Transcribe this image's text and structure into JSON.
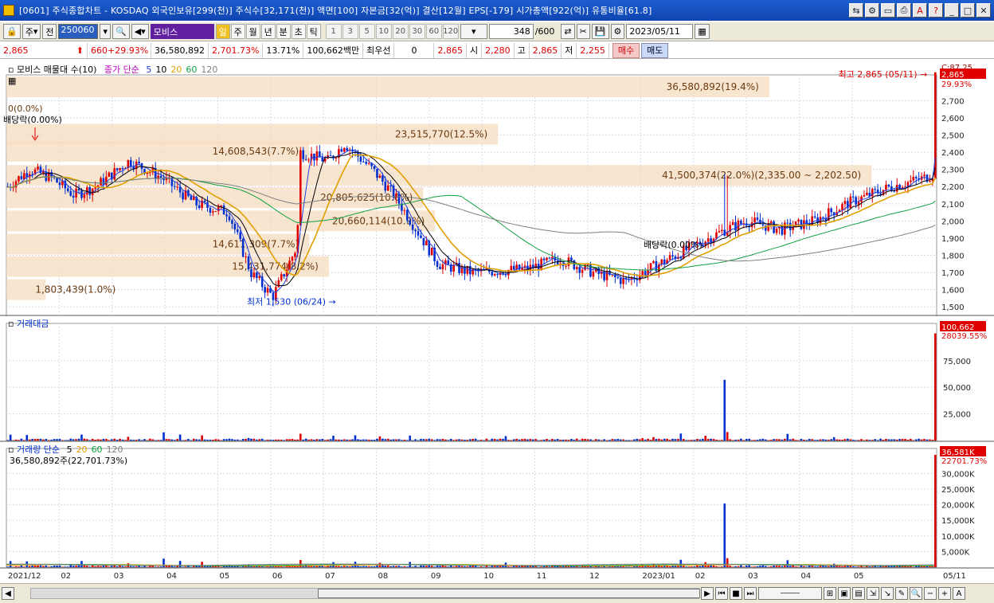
{
  "window": {
    "title": "[0601] 주식종합차트 - KOSDAQ 외국인보유[299(천)] 주식수[32,171(천)] 액면[100] 자본금[32(억)] 결산[12월] EPS[-179] 시가총액[922(억)] 유통비율[61.8]"
  },
  "toolbar": {
    "market": "주",
    "prev_label": "전",
    "stock_code": "250060",
    "stock_name": "모비스",
    "periods": [
      "일",
      "주",
      "월",
      "년",
      "분",
      "초",
      "틱"
    ],
    "active_period": "일",
    "numbers": [
      "1",
      "3",
      "5",
      "10",
      "20",
      "30",
      "60",
      "120"
    ],
    "count": "348",
    "count_total": "/600",
    "date": "2023/05/11"
  },
  "quote": {
    "price": "2,865",
    "change": "660",
    "change_pct": "+29.93%",
    "volume": "36,580,892",
    "volume_pct": "2,701.73%",
    "turnover_ratio": "13.71%",
    "amount": "100,662백만",
    "priority_label": "최우선",
    "priority_value": "0",
    "priority_price": "2,865",
    "open_label": "시",
    "open": "2,280",
    "high_label": "고",
    "high": "2,865",
    "low_label": "저",
    "low": "2,255",
    "buy": "매수",
    "sell": "매도"
  },
  "price_panel": {
    "legend_title": "모비스 매물대 수(10)",
    "ma_title": "종가 단순",
    "ma_periods": [
      "5",
      "10",
      "20",
      "60",
      "120"
    ],
    "ma_colors": [
      "#2040e0",
      "#000000",
      "#e0a000",
      "#10a040",
      "#808080"
    ],
    "top_right_tag": "C:87.25",
    "last_price_tag": "2,865",
    "last_pct_tag": "29.93%",
    "high_annotation": "최고 2,865 (05/11)",
    "low_annotation": "최저 1,530 (06/24)",
    "dividend_left_value": "0(0.0%)",
    "dividend_left_label": "배당락(0.00%)",
    "dividend_mid_label": "배당락(0.00%)",
    "y_ticks": [
      "2,700",
      "2,600",
      "2,500",
      "2,400",
      "2,300",
      "2,200",
      "2,100",
      "2,000",
      "1,900",
      "1,800",
      "1,700",
      "1,600",
      "1,500"
    ],
    "volume_profile": [
      {
        "label": "36,580,892(19.4%)",
        "price": 2780
      },
      {
        "label": "23,515,770(12.5%)",
        "price": 2505
      },
      {
        "label": "14,608,543(7.7%)",
        "price": 2405
      },
      {
        "label": "41,500,374(22.0%)(2,335.00 ~ 2,202.50)",
        "price": 2265
      },
      {
        "label": "20,805,625(10.6%)",
        "price": 2135
      },
      {
        "label": "20,660,114(10.9%)",
        "price": 2000
      },
      {
        "label": "14,611,309(7.7%)",
        "price": 1865
      },
      {
        "label": "15,431,774(8.2%)",
        "price": 1735
      },
      {
        "label": "1,803,439(1.0%)",
        "price": 1600
      }
    ]
  },
  "amount_panel": {
    "title": "거래대금",
    "last_value_tag": "100,662",
    "sub_tag": "28039.55%",
    "y_ticks": [
      "75,000",
      "50,000",
      "25,000"
    ]
  },
  "volume_panel": {
    "title": "거래량 단순",
    "ma_periods": [
      "5",
      "20",
      "60",
      "120"
    ],
    "info": "36,580,892주(22,701.73%)",
    "last_value_tag": "36,581K",
    "sub_tag": "22701.73%",
    "y_ticks": [
      "30,000K",
      "25,000K",
      "20,000K",
      "15,000K",
      "10,000K",
      "5,000K"
    ]
  },
  "x_axis": {
    "labels": [
      "2021/12",
      "02",
      "03",
      "04",
      "05",
      "06",
      "07",
      "08",
      "09",
      "10",
      "11",
      "12",
      "2023/01",
      "02",
      "03",
      "04",
      "05",
      "05/11"
    ]
  },
  "chart_data": {
    "type": "candlestick",
    "title": "모비스",
    "price_range": [
      1500,
      2865
    ],
    "key_points": [
      {
        "label": "최고",
        "date": "05/11",
        "price": 2865
      },
      {
        "label": "최저",
        "date": "06/24",
        "price": 1530
      }
    ],
    "last": {
      "date": "2023/05/11",
      "open": 2280,
      "high": 2865,
      "low": 2255,
      "close": 2865,
      "volume": 36580892,
      "amount_mil": 100662
    }
  }
}
